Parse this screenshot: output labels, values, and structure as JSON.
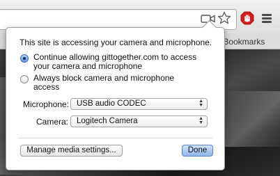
{
  "toolbar": {
    "camera_icon": "camera-blocked-icon",
    "star_icon": "bookmark-star-icon",
    "extension_icon": "red-hand-extension-icon",
    "menu_icon": "chrome-menu-icon"
  },
  "bookmarks_bar": {
    "label": "r Bookmarks"
  },
  "bubble": {
    "title": "This site is accessing your camera and microphone.",
    "options": [
      {
        "label": "Continue allowing gittogether.com to access your camera and microphone",
        "checked": true
      },
      {
        "label": "Always block camera and microphone access",
        "checked": false
      }
    ],
    "microphone_label": "Microphone:",
    "microphone_value": "USB audio CODEC",
    "camera_label": "Camera:",
    "camera_value": "Logitech Camera",
    "manage_button": "Manage media settings...",
    "done_button": "Done"
  },
  "colors": {
    "accent": "#5d95e3",
    "extension_red": "#d31c1c"
  }
}
